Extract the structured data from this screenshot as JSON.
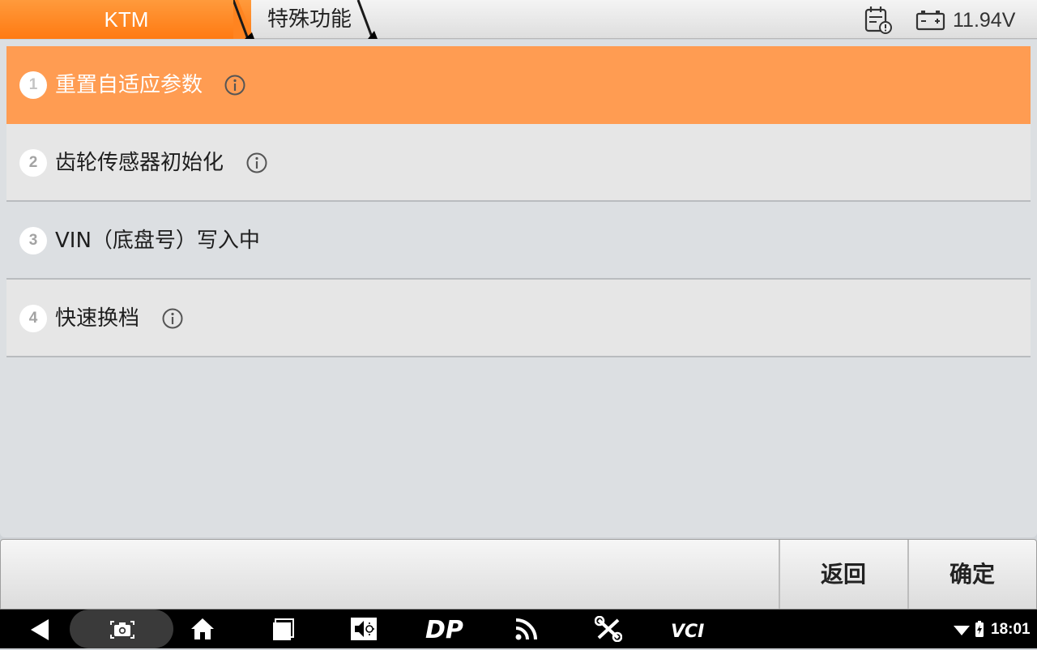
{
  "header": {
    "breadcrumb": [
      {
        "label": "KTM"
      },
      {
        "label": "特殊功能"
      }
    ],
    "voltage": "11.94V",
    "icons": [
      "calendar-alert-icon",
      "battery-icon"
    ]
  },
  "menu": {
    "items": [
      {
        "number": "1",
        "label": "重置自适应参数",
        "has_info": true,
        "selected": true
      },
      {
        "number": "2",
        "label": "齿轮传感器初始化",
        "has_info": true,
        "selected": false
      },
      {
        "number": "3",
        "label": "VIN（底盘号）写入中",
        "has_info": false,
        "selected": false
      },
      {
        "number": "4",
        "label": "快速换档",
        "has_info": true,
        "selected": false
      }
    ]
  },
  "actions": {
    "back_label": "返回",
    "confirm_label": "确定"
  },
  "system_bar": {
    "icons": [
      "back-icon",
      "screenshot-icon",
      "home-icon",
      "recent-apps-icon",
      "volume-icon",
      "dp-icon",
      "cast-icon",
      "tools-icon",
      "vci-icon"
    ],
    "dp_label": "DP",
    "vci_label": "VCI",
    "time": "18:01"
  },
  "colors": {
    "accent": "#ff9c52",
    "breadcrumb_home": "#ff7a12"
  }
}
